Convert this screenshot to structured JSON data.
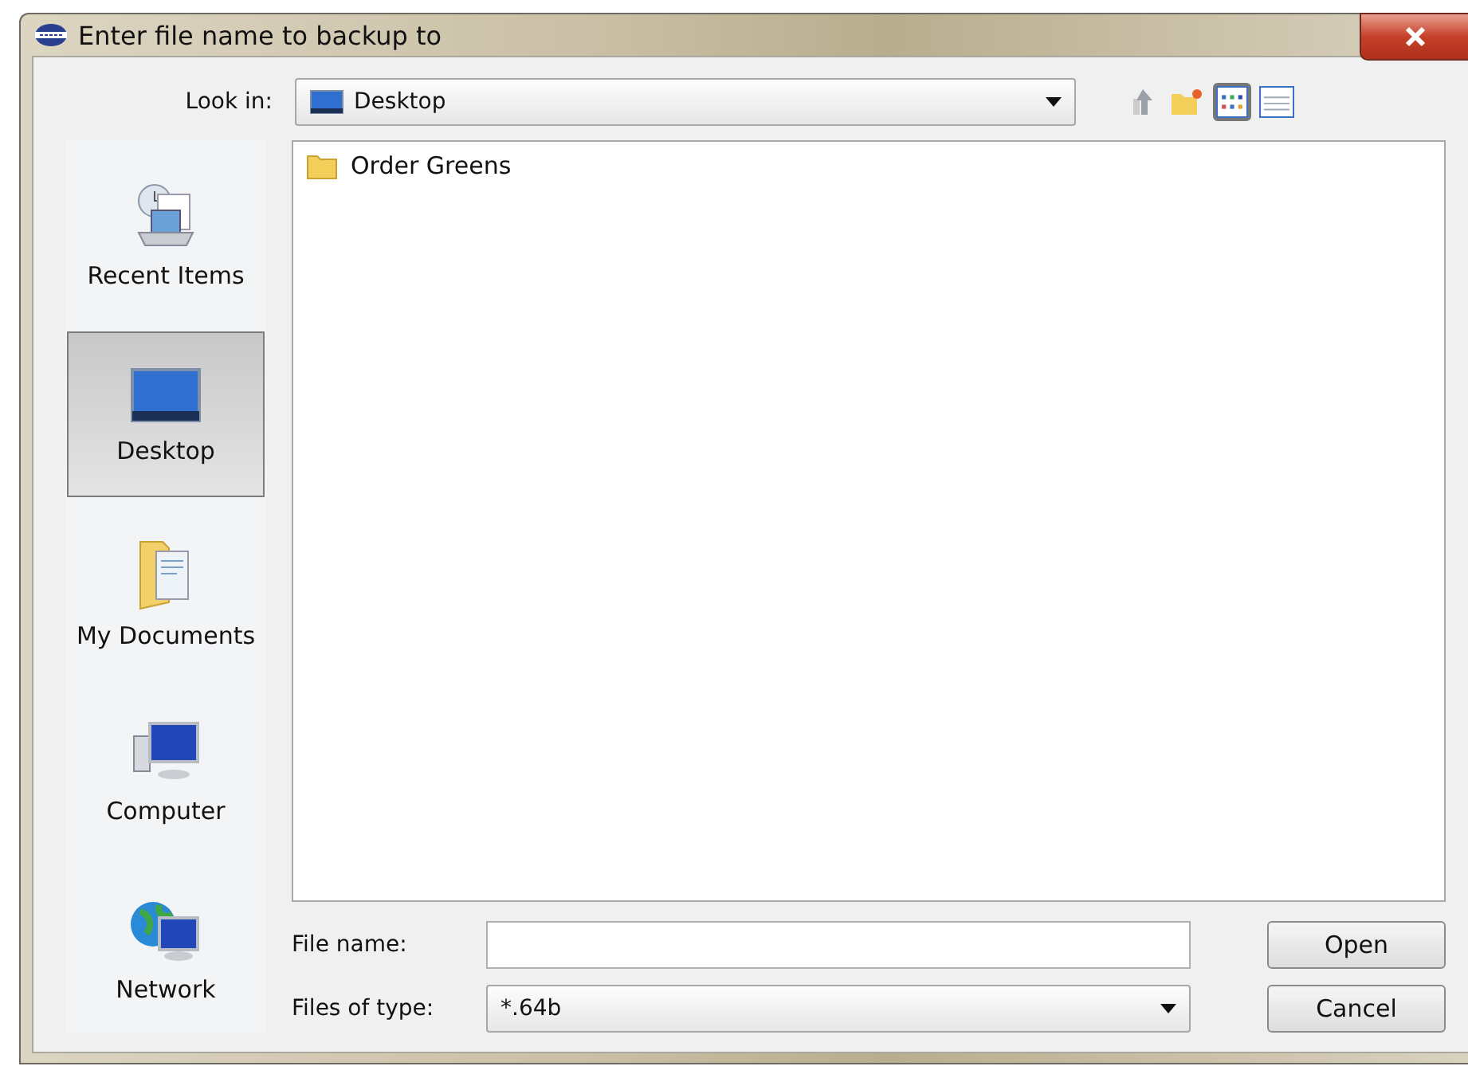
{
  "window": {
    "title": "Enter file name to backup to"
  },
  "look_in": {
    "label": "Look in:",
    "value": "Desktop"
  },
  "view_buttons": [
    {
      "kind": "list",
      "selected": true
    },
    {
      "kind": "details",
      "selected": false
    }
  ],
  "places": [
    {
      "kind": "recent",
      "label": "Recent Items",
      "selected": false
    },
    {
      "kind": "desktop",
      "label": "Desktop",
      "selected": true
    },
    {
      "kind": "documents",
      "label": "My Documents",
      "selected": false
    },
    {
      "kind": "computer",
      "label": "Computer",
      "selected": false
    },
    {
      "kind": "network",
      "label": "Network",
      "selected": false
    }
  ],
  "files": [
    {
      "kind": "folder",
      "name": "Order Greens"
    }
  ],
  "file_name": {
    "label": "File name:"
  },
  "file_type": {
    "label": "Files of type:",
    "value": "*.64b"
  },
  "buttons": [
    "Open",
    "Cancel"
  ]
}
